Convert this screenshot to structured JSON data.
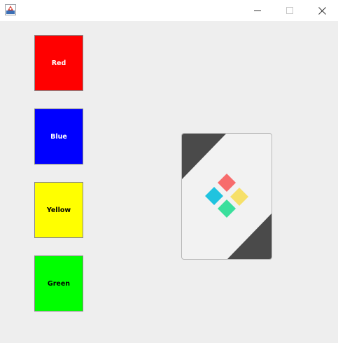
{
  "window": {
    "icon": "java-app-icon",
    "controls": {
      "minimize_icon": "minimize-icon",
      "maximize_icon": "maximize-icon",
      "close_icon": "close-icon"
    }
  },
  "color_buttons": [
    {
      "label": "Red",
      "bg": "#ff0000",
      "fg": "#ffffff"
    },
    {
      "label": "Blue",
      "bg": "#0000ff",
      "fg": "#ffffff"
    },
    {
      "label": "Yellow",
      "bg": "#ffff00",
      "fg": "#000000"
    },
    {
      "label": "Green",
      "bg": "#00ff00",
      "fg": "#000000"
    }
  ],
  "card": {
    "face_color": "#f2f2f2",
    "corner_color": "#4a4a4a",
    "logo": {
      "icon": "four-color-diamond-logo-icon",
      "colors": {
        "top": "#f76c6c",
        "right": "#f6e069",
        "bottom": "#3adf9c",
        "left": "#20c3df"
      }
    }
  }
}
